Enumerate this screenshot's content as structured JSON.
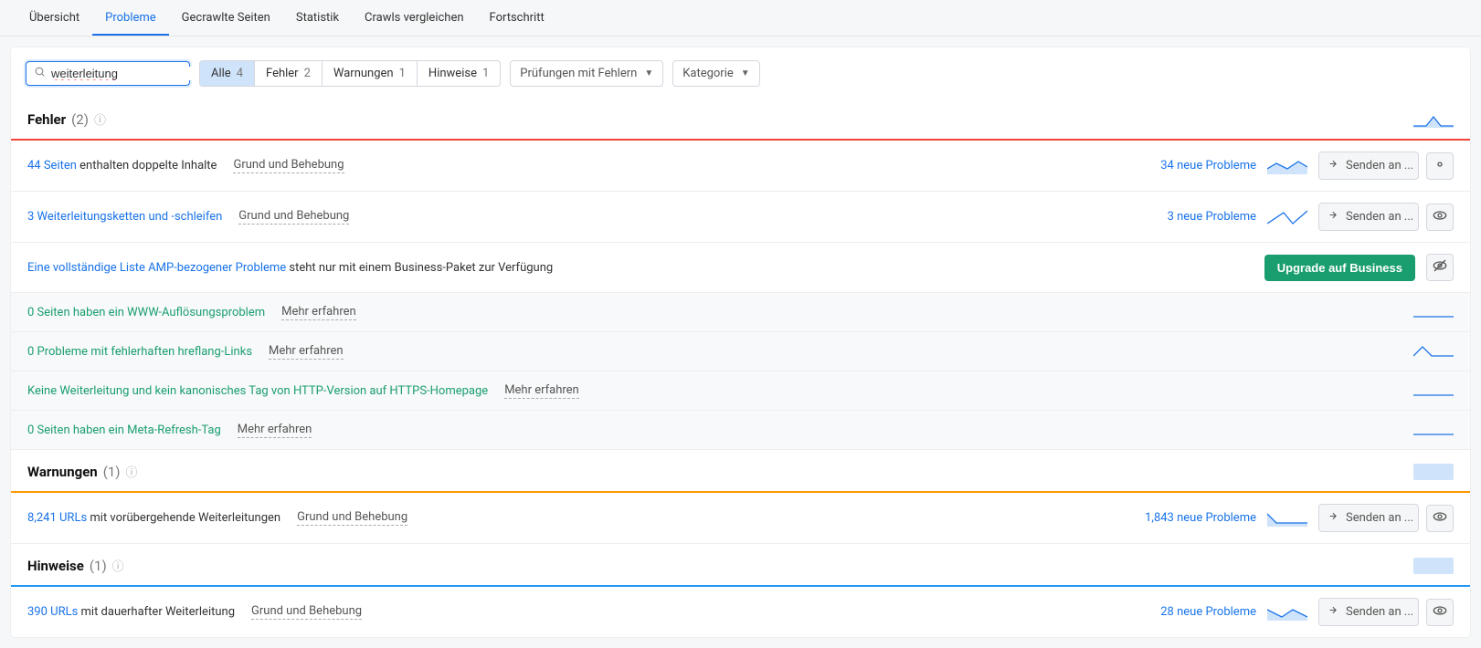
{
  "topnav": {
    "items": [
      {
        "label": "Übersicht"
      },
      {
        "label": "Probleme"
      },
      {
        "label": "Gecrawlte Seiten"
      },
      {
        "label": "Statistik"
      },
      {
        "label": "Crawls vergleichen"
      },
      {
        "label": "Fortschritt"
      }
    ]
  },
  "search": {
    "value": "weiterleitung"
  },
  "filters": {
    "segments": [
      {
        "label": "Alle",
        "count": "4"
      },
      {
        "label": "Fehler",
        "count": "2"
      },
      {
        "label": "Warnungen",
        "count": "1"
      },
      {
        "label": "Hinweise",
        "count": "1"
      }
    ],
    "dd1": "Prüfungen mit Fehlern",
    "dd2": "Kategorie"
  },
  "sections": {
    "errors": {
      "title": "Fehler",
      "count": "(2)"
    },
    "warnings": {
      "title": "Warnungen",
      "count": "(1)"
    },
    "notices": {
      "title": "Hinweise",
      "count": "(1)"
    }
  },
  "labels": {
    "reason": "Grund und Behebung",
    "learn": "Mehr erfahren",
    "send": "Senden an ...",
    "upgrade": "Upgrade auf Business"
  },
  "errors_rows": [
    {
      "link": "44 Seiten",
      "text": " enthalten doppelte Inhalte",
      "new": "34 neue Probleme"
    },
    {
      "link": "3 Weiterleitungsketten und -schleifen",
      "text": "",
      "new": "3 neue Probleme"
    }
  ],
  "amp_row": {
    "link": "Eine vollständige Liste AMP-bezogener Probleme",
    "text": " steht nur mit einem Business-Paket zur Verfügung"
  },
  "muted_rows": [
    {
      "link": "0 Seiten haben ein WWW-Auflösungsproblem"
    },
    {
      "link": "0 Probleme mit fehlerhaften hreflang-Links"
    },
    {
      "link": "Keine Weiterleitung und kein kanonisches Tag von HTTP-Version auf HTTPS-Homepage"
    },
    {
      "link": "0 Seiten haben ein Meta-Refresh-Tag"
    }
  ],
  "warnings_rows": [
    {
      "link": "8,241 URLs",
      "text": " mit vorübergehende Weiterleitungen",
      "new": "1,843 neue Probleme"
    }
  ],
  "notices_rows": [
    {
      "link": "390 URLs",
      "text": " mit dauerhafter Weiterleitung",
      "new": "28 neue Probleme"
    }
  ]
}
